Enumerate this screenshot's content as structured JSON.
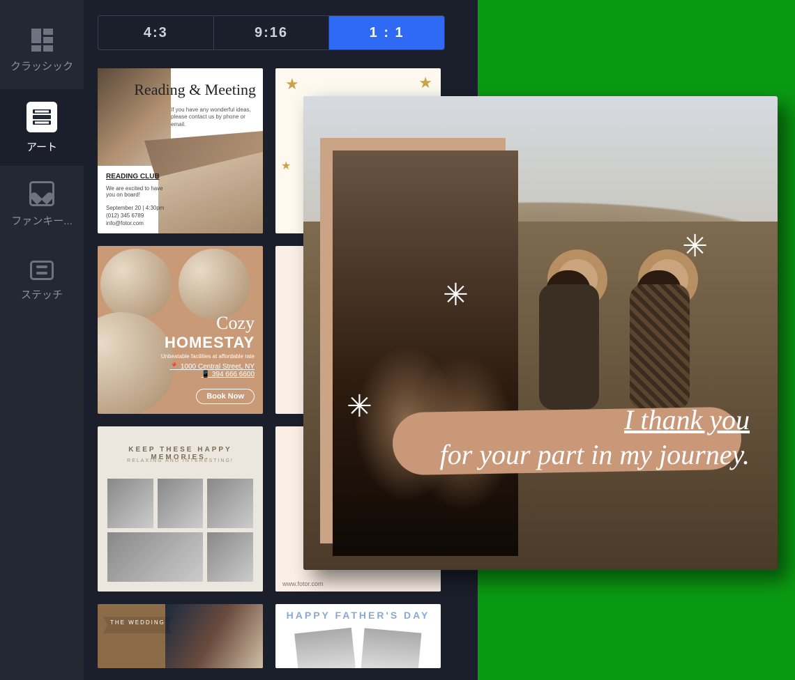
{
  "sidebar": {
    "items": [
      {
        "label": "クラッシック",
        "icon": "classic-icon",
        "active": false
      },
      {
        "label": "アート",
        "icon": "art-icon",
        "active": true
      },
      {
        "label": "ファンキー...",
        "icon": "heart-icon",
        "active": false
      },
      {
        "label": "ステッチ",
        "icon": "stitch-icon",
        "active": false
      }
    ]
  },
  "ratio_tabs": [
    {
      "label": "4:3",
      "active": false
    },
    {
      "label": "9:16",
      "active": false
    },
    {
      "label": "1 : 1",
      "active": true
    }
  ],
  "templates": {
    "t1": {
      "title": "Reading & Meeting",
      "sub": "If you have any wonderful ideas, please contact us by phone or email.",
      "club": "READING CLUB",
      "board": "We are excited to have you on board!",
      "meta_date": "September 20 | 4:30pm",
      "meta_tel": "(012) 345 6789",
      "meta_mail": "info@fotor.com"
    },
    "t3": {
      "cozy": "Cozy",
      "home": "HOMESTAY",
      "tag": "Unbeatable facilities at affordable rate",
      "addr": "1000 Central Street, NY",
      "tel": "394 666 6600",
      "btn": "Book Now"
    },
    "t5": {
      "h1": "KEEP THESE HAPPY MEMORIES.",
      "h2": "RELAXING AND INTERESTING!"
    },
    "t6": {
      "footer": "www.fotor.com"
    },
    "t7": {
      "band": "THE WEDDING"
    },
    "t8": {
      "h": "HAPPY FATHER'S DAY"
    }
  },
  "canvas": {
    "line1": "I thank you",
    "line2": "for your part in my journey."
  },
  "colors": {
    "accent": "#2f6af5",
    "backdrop": "#0a9a12",
    "panel": "#1a1f2b"
  }
}
